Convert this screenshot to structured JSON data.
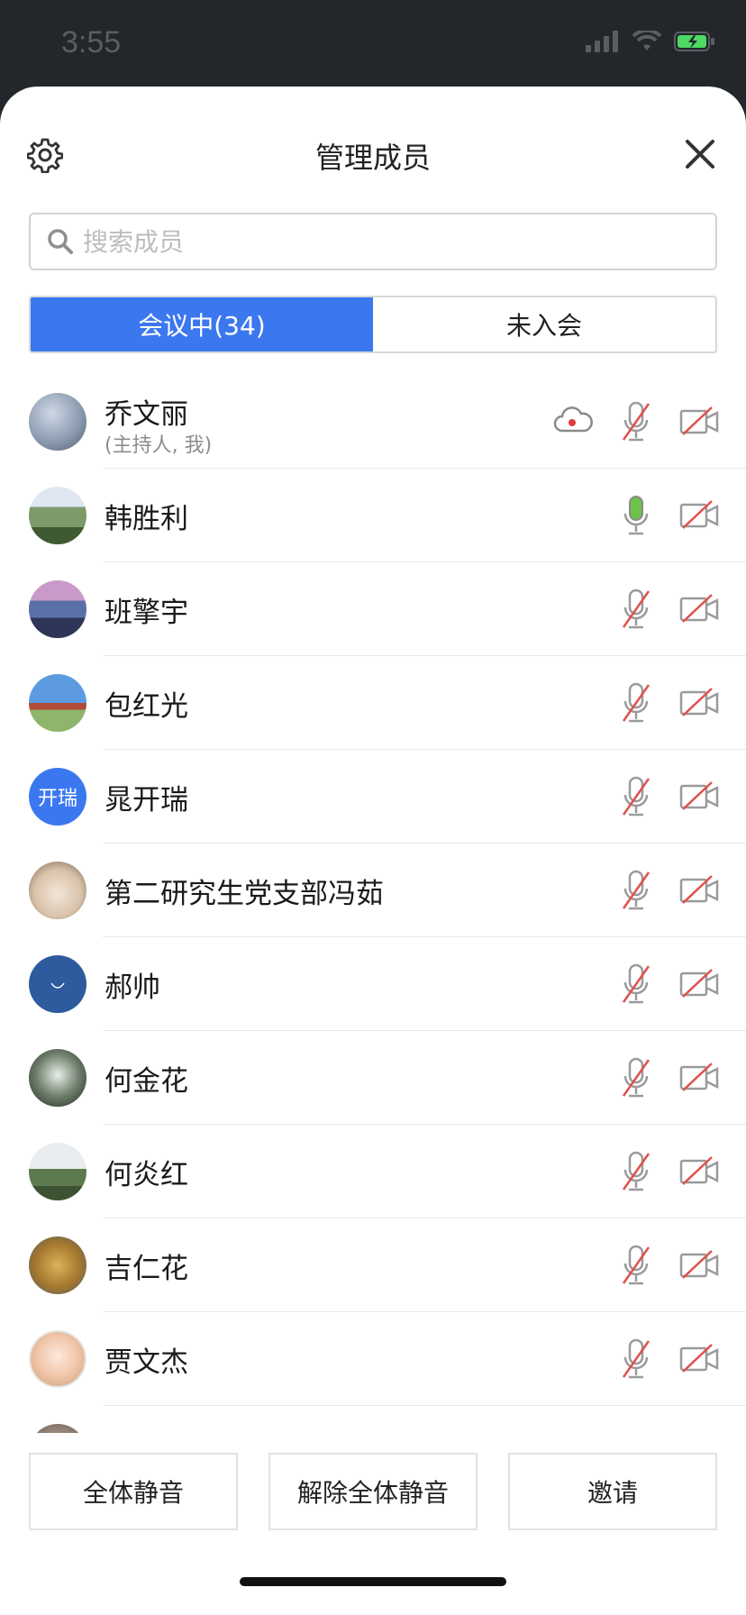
{
  "status_bar": {
    "time": "3:55"
  },
  "header": {
    "title": "管理成员"
  },
  "search": {
    "placeholder": "搜索成员"
  },
  "tabs": [
    {
      "label": "会议中(34)",
      "active": true
    },
    {
      "label": "未入会",
      "active": false
    }
  ],
  "members": [
    {
      "name": "乔文丽",
      "subtitle": "(主持人, 我)",
      "avatar_text": "",
      "mic": "muted",
      "camera": "off",
      "recording_icon": "cloud-record-icon"
    },
    {
      "name": "韩胜利",
      "subtitle": "",
      "avatar_text": "",
      "mic": "active",
      "camera": "off"
    },
    {
      "name": "班擎宇",
      "subtitle": "",
      "avatar_text": "",
      "mic": "muted",
      "camera": "off"
    },
    {
      "name": "包红光",
      "subtitle": "",
      "avatar_text": "",
      "mic": "muted",
      "camera": "off"
    },
    {
      "name": "晁开瑞",
      "subtitle": "",
      "avatar_text": "开瑞",
      "mic": "muted",
      "camera": "off"
    },
    {
      "name": "第二研究生党支部冯茹",
      "subtitle": "",
      "avatar_text": "",
      "mic": "muted",
      "camera": "off"
    },
    {
      "name": "郝帅",
      "subtitle": "",
      "avatar_text": "",
      "mic": "muted",
      "camera": "off"
    },
    {
      "name": "何金花",
      "subtitle": "",
      "avatar_text": "",
      "mic": "muted",
      "camera": "off"
    },
    {
      "name": "何炎红",
      "subtitle": "",
      "avatar_text": "",
      "mic": "muted",
      "camera": "off"
    },
    {
      "name": "吉仁花",
      "subtitle": "",
      "avatar_text": "",
      "mic": "muted",
      "camera": "off"
    },
    {
      "name": "贾文杰",
      "subtitle": "",
      "avatar_text": "",
      "mic": "muted",
      "camera": "off"
    }
  ],
  "footer": {
    "mute_all": "全体静音",
    "unmute_all": "解除全体静音",
    "invite": "邀请"
  },
  "colors": {
    "accent": "#3b78f0",
    "muted_red": "#e0514d",
    "mic_active": "#6cc24a",
    "icon_gray": "#8a8a8a"
  }
}
